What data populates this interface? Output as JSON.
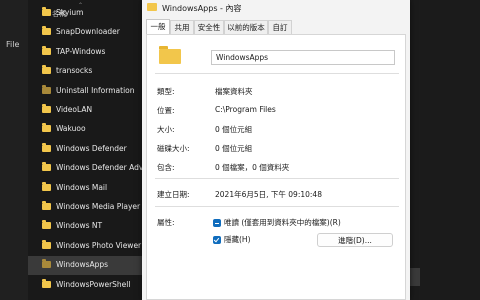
{
  "explorer": {
    "left_label": "File",
    "column_header": "名稱",
    "items": [
      {
        "label": "Skyium",
        "dim": false
      },
      {
        "label": "SnapDownloader",
        "dim": false
      },
      {
        "label": "TAP-Windows",
        "dim": false
      },
      {
        "label": "transocks",
        "dim": false
      },
      {
        "label": "Uninstall Information",
        "dim": true
      },
      {
        "label": "VideoLAN",
        "dim": false
      },
      {
        "label": "Wakuoo",
        "dim": false
      },
      {
        "label": "Windows Defender",
        "dim": false
      },
      {
        "label": "Windows Defender Adva",
        "dim": false
      },
      {
        "label": "Windows Mail",
        "dim": false
      },
      {
        "label": "Windows Media Player",
        "dim": false
      },
      {
        "label": "Windows NT",
        "dim": false
      },
      {
        "label": "Windows Photo Viewer",
        "dim": false
      },
      {
        "label": "WindowsApps",
        "dim": true,
        "selected": true
      },
      {
        "label": "WindowsPowerShell",
        "dim": false
      }
    ]
  },
  "dialog": {
    "title": "WindowsApps - 內容",
    "tabs": [
      "一般",
      "共用",
      "安全性",
      "以前的版本",
      "自訂"
    ],
    "active_tab": 0,
    "folder_name": "WindowsApps",
    "props": {
      "type_label": "類型:",
      "type_value": "檔案資料夾",
      "location_label": "位置:",
      "location_value": "C:\\Program Files",
      "size_label": "大小:",
      "size_value": "0 個位元組",
      "disk_label": "磁碟大小:",
      "disk_value": "0 個位元組",
      "contains_label": "包含:",
      "contains_value": "0 個檔案，0 個資料夾",
      "created_label": "建立日期:",
      "created_value": "2021年6月5日, 下午 09:10:48",
      "attr_label": "屬性:",
      "readonly_label": "唯讀 (僅套用到資料夾中的檔案)(R)",
      "hidden_label": "隱藏(H)",
      "advanced_label": "進階(D)..."
    }
  }
}
